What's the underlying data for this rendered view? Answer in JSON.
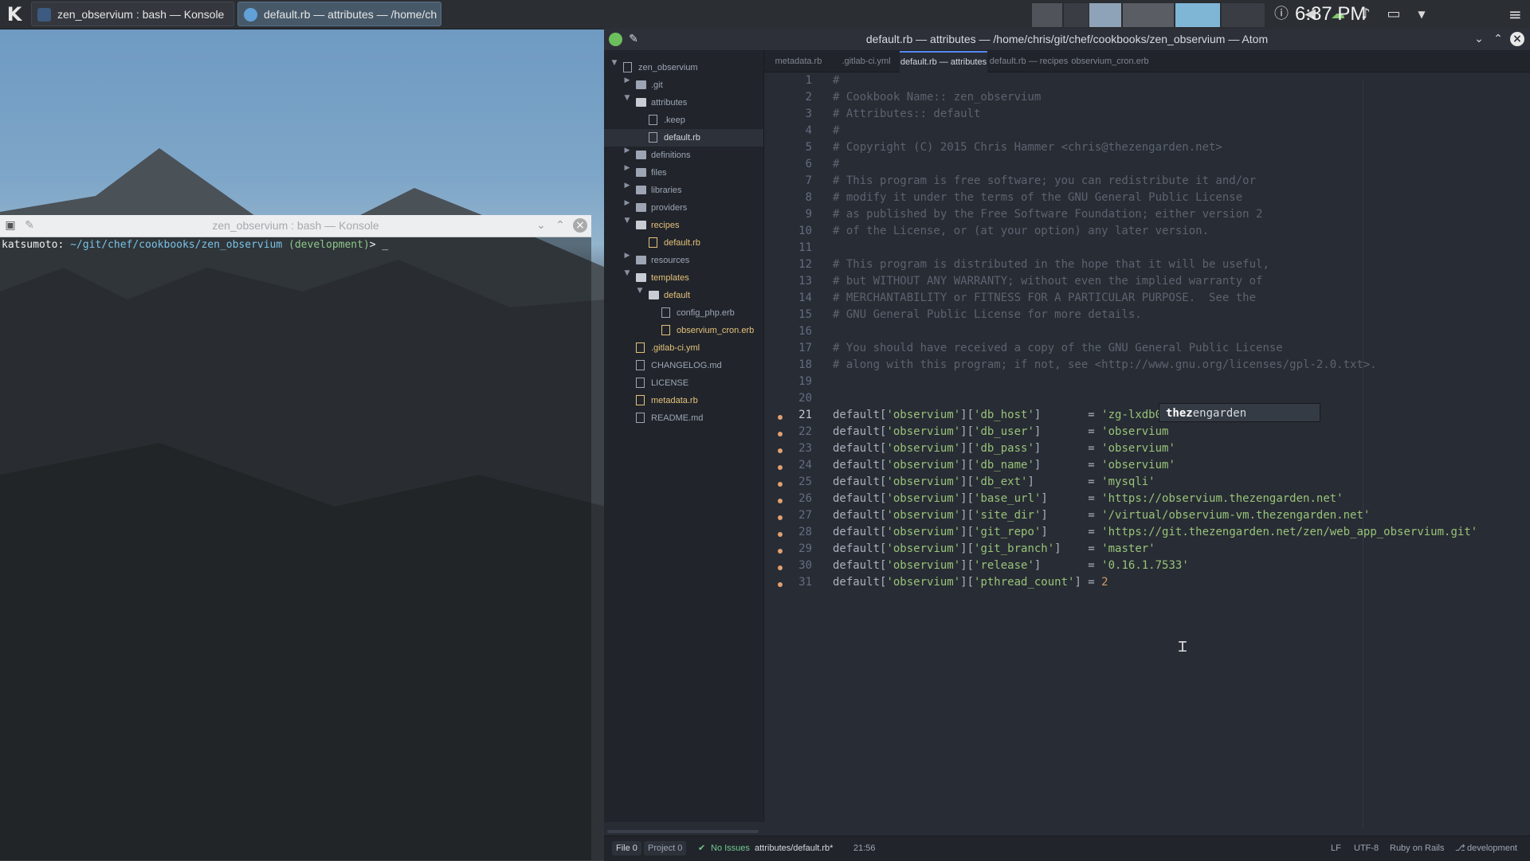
{
  "taskbar": {
    "tasks": [
      {
        "label": "zen_observium : bash — Konsole"
      },
      {
        "label": "default.rb — attributes — /home/ch"
      }
    ],
    "clock": "6:37 PM"
  },
  "konsole": {
    "title": "zen_observium : bash — Konsole",
    "prompt_user": "katsumoto: ",
    "prompt_path": "~/git/chef/cookbooks/zen_observium",
    "prompt_branch": " (development)",
    "prompt_tail": "> _"
  },
  "atom": {
    "title": "default.rb — attributes — /home/chris/git/chef/cookbooks/zen_observium — Atom",
    "tree": [
      {
        "label": "zen_observium",
        "type": "root",
        "depth": 0,
        "open": true
      },
      {
        "label": ".git",
        "type": "folder",
        "depth": 1,
        "open": false
      },
      {
        "label": "attributes",
        "type": "folder",
        "depth": 1,
        "open": true
      },
      {
        "label": ".keep",
        "type": "file",
        "depth": 2
      },
      {
        "label": "default.rb",
        "type": "file",
        "depth": 2,
        "selected": true
      },
      {
        "label": "definitions",
        "type": "folder",
        "depth": 1,
        "open": false
      },
      {
        "label": "files",
        "type": "folder",
        "depth": 1,
        "open": false
      },
      {
        "label": "libraries",
        "type": "folder",
        "depth": 1,
        "open": false
      },
      {
        "label": "providers",
        "type": "folder",
        "depth": 1,
        "open": false
      },
      {
        "label": "recipes",
        "type": "folder",
        "depth": 1,
        "open": true,
        "modified": true
      },
      {
        "label": "default.rb",
        "type": "file",
        "depth": 2,
        "modified": true
      },
      {
        "label": "resources",
        "type": "folder",
        "depth": 1,
        "open": false
      },
      {
        "label": "templates",
        "type": "folder",
        "depth": 1,
        "open": true,
        "modified": true
      },
      {
        "label": "default",
        "type": "folder",
        "depth": 2,
        "open": true,
        "modified": true
      },
      {
        "label": "config_php.erb",
        "type": "file",
        "depth": 3
      },
      {
        "label": "observium_cron.erb",
        "type": "file",
        "depth": 3,
        "modified": true
      },
      {
        "label": ".gitlab-ci.yml",
        "type": "file",
        "depth": 1,
        "modified": true
      },
      {
        "label": "CHANGELOG.md",
        "type": "file",
        "depth": 1
      },
      {
        "label": "LICENSE",
        "type": "file",
        "depth": 1
      },
      {
        "label": "metadata.rb",
        "type": "file",
        "depth": 1,
        "modified": true
      },
      {
        "label": "README.md",
        "type": "file",
        "depth": 1
      }
    ],
    "tabs": [
      {
        "label": "metadata.rb",
        "active": false
      },
      {
        "label": ".gitlab-ci.yml",
        "active": false
      },
      {
        "label": "default.rb — attributes",
        "active": true
      },
      {
        "label": "default.rb — recipes",
        "active": false
      },
      {
        "label": "observium_cron.erb",
        "active": false
      }
    ],
    "code": [
      {
        "n": "1",
        "c": "#"
      },
      {
        "n": "2",
        "c": "# Cookbook Name:: zen_observium"
      },
      {
        "n": "3",
        "c": "# Attributes:: default"
      },
      {
        "n": "4",
        "c": "#"
      },
      {
        "n": "5",
        "c": "# Copyright (C) 2015 Chris Hammer <chris@thezengarden.net>"
      },
      {
        "n": "6",
        "c": "#"
      },
      {
        "n": "7",
        "c": "# This program is free software; you can redistribute it and/or"
      },
      {
        "n": "8",
        "c": "# modify it under the terms of the GNU General Public License"
      },
      {
        "n": "9",
        "c": "# as published by the Free Software Foundation; either version 2"
      },
      {
        "n": "10",
        "c": "# of the License, or (at your option) any later version."
      },
      {
        "n": "11",
        "c": ""
      },
      {
        "n": "12",
        "c": "# This program is distributed in the hope that it will be useful,"
      },
      {
        "n": "13",
        "c": "# but WITHOUT ANY WARRANTY; without even the implied warranty of"
      },
      {
        "n": "14",
        "c": "# MERCHANTABILITY or FITNESS FOR A PARTICULAR PURPOSE.  See the"
      },
      {
        "n": "15",
        "c": "# GNU General Public License for more details."
      },
      {
        "n": "16",
        "c": ""
      },
      {
        "n": "17",
        "c": "# You should have received a copy of the GNU General Public License"
      },
      {
        "n": "18",
        "c": "# along with this program; if not, see <http://www.gnu.org/licenses/gpl-2.0.txt>."
      },
      {
        "n": "19",
        "c": ""
      },
      {
        "n": "20",
        "c": ""
      },
      {
        "n": "21",
        "k": "db_host",
        "pad": "      ",
        "v": "'zg-lxdb01.thez'",
        "cur": true
      },
      {
        "n": "22",
        "k": "db_user",
        "pad": "      ",
        "v": "'observium"
      },
      {
        "n": "23",
        "k": "db_pass",
        "pad": "      ",
        "v": "'observium'"
      },
      {
        "n": "24",
        "k": "db_name",
        "pad": "      ",
        "v": "'observium'"
      },
      {
        "n": "25",
        "k": "db_ext",
        "pad": "       ",
        "v": "'mysqli'"
      },
      {
        "n": "26",
        "k": "base_url",
        "pad": "     ",
        "v": "'https://observium.thezengarden.net'"
      },
      {
        "n": "27",
        "k": "site_dir",
        "pad": "     ",
        "v": "'/virtual/observium-vm.thezengarden.net'"
      },
      {
        "n": "28",
        "k": "git_repo",
        "pad": "     ",
        "v": "'https://git.thezengarden.net/zen/web_app_observium.git'"
      },
      {
        "n": "29",
        "k": "git_branch",
        "pad": "   ",
        "v": "'master'"
      },
      {
        "n": "30",
        "k": "release",
        "pad": "      ",
        "v": "'0.16.1.7533'"
      },
      {
        "n": "31",
        "k": "pthread_count",
        "pad": "",
        "v": "2",
        "num": true
      }
    ],
    "autocomplete": {
      "typed": "thez",
      "rest": "engarden"
    },
    "status": {
      "file": "File 0",
      "project": "Project 0",
      "issues": "No Issues",
      "path": "attributes/default.rb*",
      "cursor": "21:56",
      "eol": "LF",
      "encoding": "UTF-8",
      "grammar": "Ruby on Rails",
      "branch": "development"
    }
  }
}
